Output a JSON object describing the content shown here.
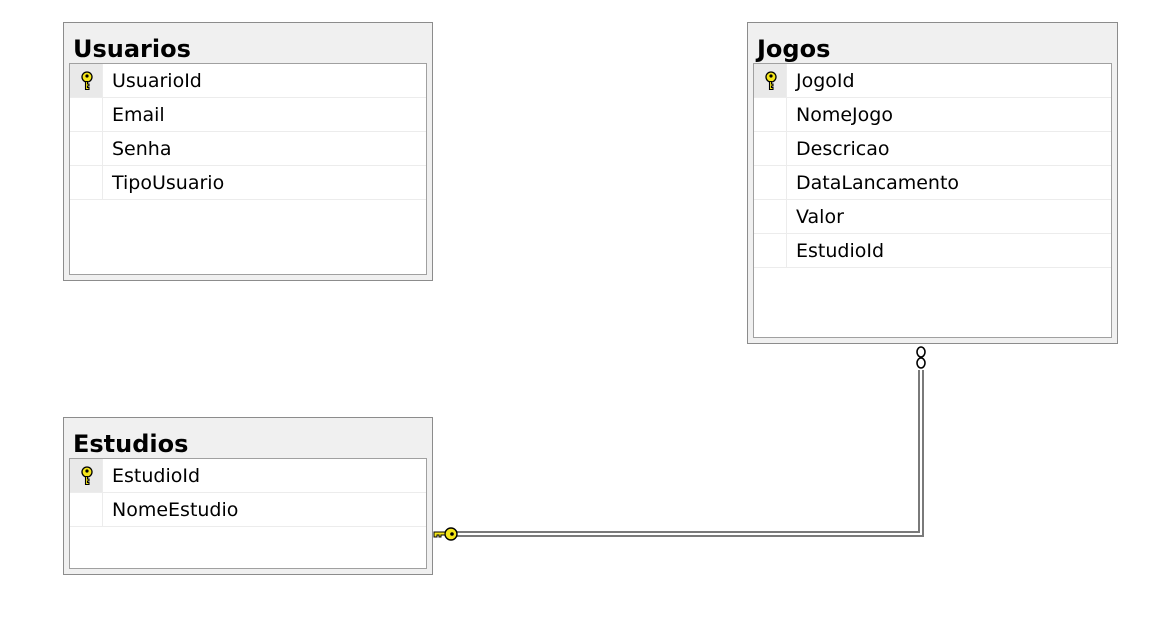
{
  "tables": {
    "usuarios": {
      "title": "Usuarios",
      "columns": [
        {
          "name": "UsuarioId",
          "primary_key": true
        },
        {
          "name": "Email",
          "primary_key": false
        },
        {
          "name": "Senha",
          "primary_key": false
        },
        {
          "name": "TipoUsuario",
          "primary_key": false
        }
      ]
    },
    "jogos": {
      "title": "Jogos",
      "columns": [
        {
          "name": "JogoId",
          "primary_key": true
        },
        {
          "name": "NomeJogo",
          "primary_key": false
        },
        {
          "name": "Descricao",
          "primary_key": false
        },
        {
          "name": "DataLancamento",
          "primary_key": false
        },
        {
          "name": "Valor",
          "primary_key": false
        },
        {
          "name": "EstudioId",
          "primary_key": false
        }
      ]
    },
    "estudios": {
      "title": "Estudios",
      "columns": [
        {
          "name": "EstudioId",
          "primary_key": true
        },
        {
          "name": "NomeEstudio",
          "primary_key": false
        }
      ]
    }
  },
  "relationships": [
    {
      "from": "estudios",
      "to": "jogos",
      "from_end": "key-icon",
      "to_end": "infinity-icon"
    }
  ],
  "colors": {
    "key_icon": "#f5e61a",
    "header_bg": "#f0f0f0",
    "border": "#8c8c8c"
  }
}
